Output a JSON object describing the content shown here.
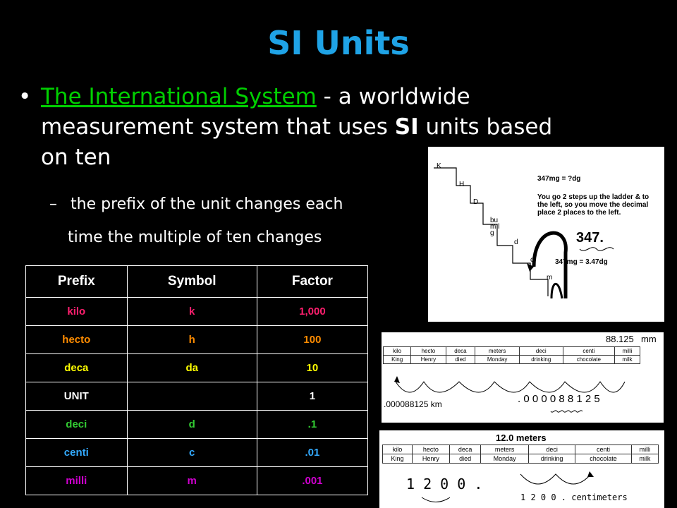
{
  "slide": {
    "title": "SI Units",
    "bullet": {
      "marker": "•",
      "term": "The International System",
      "dash": " - ",
      "text_part1": "a worldwide measurement system that uses ",
      "bold_si": "SI",
      "text_part2": " units based on ten"
    },
    "sub_bullet": {
      "marker": "–",
      "line1": "the prefix of the unit changes each",
      "line2": "time the multiple of ten changes"
    },
    "table": {
      "headers": [
        "Prefix",
        "Symbol",
        "Factor"
      ],
      "rows": [
        {
          "prefix": "kilo",
          "symbol": "k",
          "factor": "1,000",
          "color": "#ff1f6e"
        },
        {
          "prefix": "hecto",
          "symbol": "h",
          "factor": "100",
          "color": "#ff8c00"
        },
        {
          "prefix": "deca",
          "symbol": "da",
          "factor": "10",
          "color": "#ffff00"
        },
        {
          "prefix": "UNIT",
          "symbol": "",
          "factor": "1",
          "color": "#ffffff"
        },
        {
          "prefix": "deci",
          "symbol": "d",
          "factor": ".1",
          "color": "#33cc33"
        },
        {
          "prefix": "centi",
          "symbol": "c",
          "factor": ".01",
          "color": "#33aaff"
        },
        {
          "prefix": "milli",
          "symbol": "m",
          "factor": ".001",
          "color": "#d000d0"
        }
      ]
    }
  },
  "ladder_image": {
    "steps": [
      "K",
      "H",
      "D",
      "bu m l g",
      "d",
      "c",
      "m"
    ],
    "note_top": "347mg = ?dg",
    "note_mid": "You go 2 steps up the ladder & to the left, so you move the decimal place 2 places to the left.",
    "big_number": "347.",
    "note_bottom": "347mg = 3.47dg"
  },
  "khd_image": {
    "top_value": "88.125",
    "top_unit": "mm",
    "row1": [
      "kilo",
      "hecto",
      "deca",
      "meters",
      "deci",
      "centi",
      "milli"
    ],
    "row2": [
      "King",
      "Henry",
      "died",
      "Monday",
      "drinking",
      "chocolate",
      "milk"
    ],
    "left_value": ".000088125 km",
    "right_digits": ". 0 0 0 0 8 8 1 2 5"
  },
  "meters_image": {
    "top_value": "12.0 meters",
    "row1": [
      "kilo",
      "hecto",
      "deca",
      "meters",
      "deci",
      "centi",
      "milli"
    ],
    "row2": [
      "King",
      "Henry",
      "died",
      "Monday",
      "drinking",
      "chocolate",
      "milk"
    ],
    "left_value": "1 2 0 0 .",
    "right_value": "1 2 0 0 . centimeters"
  }
}
